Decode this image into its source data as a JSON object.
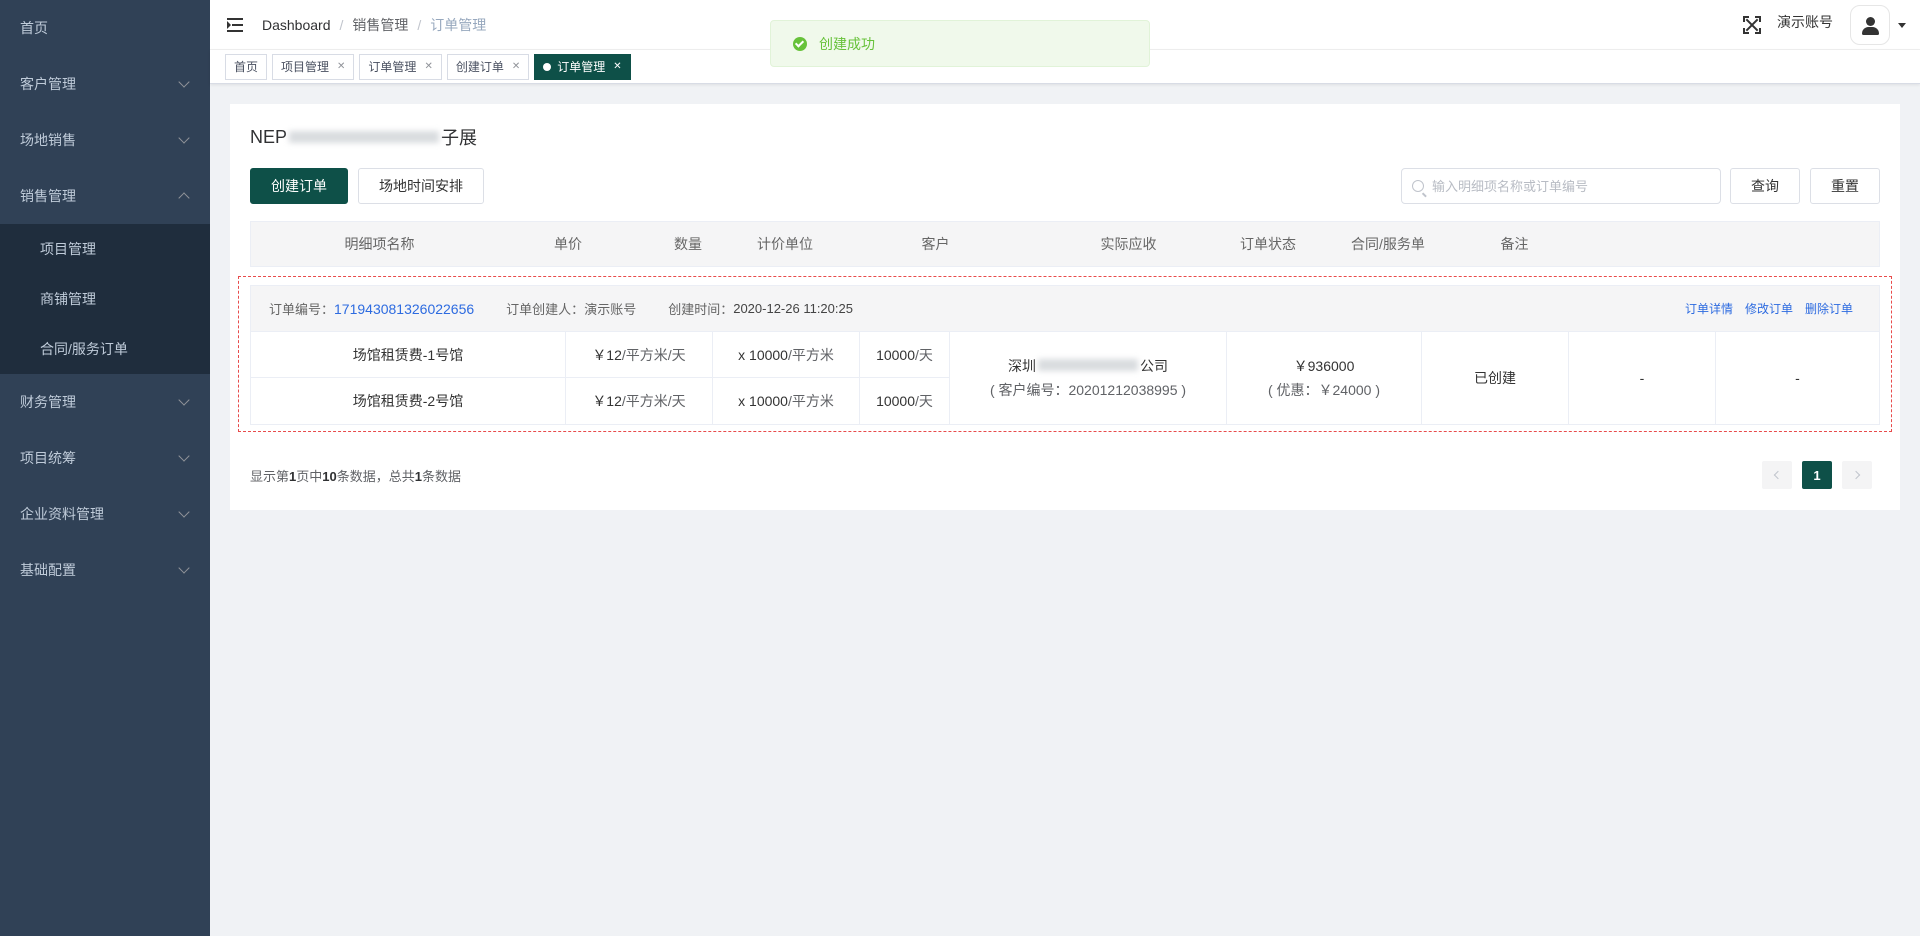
{
  "sidebar": {
    "items": [
      {
        "label": "首页"
      },
      {
        "label": "客户管理"
      },
      {
        "label": "场地销售"
      },
      {
        "label": "销售管理"
      },
      {
        "label": "财务管理"
      },
      {
        "label": "项目统筹"
      },
      {
        "label": "企业资料管理"
      },
      {
        "label": "基础配置"
      }
    ],
    "sales_submenu": [
      {
        "label": "项目管理"
      },
      {
        "label": "商铺管理"
      },
      {
        "label": "合同/服务订单"
      }
    ]
  },
  "navbar": {
    "breadcrumb": [
      "Dashboard",
      "销售管理",
      "订单管理"
    ],
    "user_name": "演示账号"
  },
  "tags": [
    {
      "label": "首页"
    },
    {
      "label": "项目管理"
    },
    {
      "label": "订单管理"
    },
    {
      "label": "创建订单"
    },
    {
      "label": "订单管理",
      "active": true
    }
  ],
  "toast": {
    "message": "创建成功"
  },
  "main": {
    "project_title_prefix": "NEP",
    "project_title_suffix": "子展",
    "create_order_label": "创建订单",
    "schedule_label": "场地时间安排",
    "search_placeholder": "输入明细项名称或订单编号",
    "query_label": "查询",
    "reset_label": "重置",
    "columns": [
      "明细项名称",
      "单价",
      "数量",
      "计价单位",
      "客户",
      "实际应收",
      "订单状态",
      "合同/服务单",
      "备注"
    ]
  },
  "order": {
    "no_label": "订单编号：",
    "no_value": "171943081326022656",
    "creator_label": "订单创建人：",
    "creator_value": "演示账号",
    "time_label": "创建时间：",
    "time_value": "2020-12-26 11:20:25",
    "actions": [
      "订单详情",
      "修改订单",
      "删除订单"
    ],
    "items": [
      {
        "name": "场馆租赁费-1号馆",
        "price": "￥12",
        "price_unit": "/平方米/天",
        "qty": "x 10000",
        "qty_unit": "/平方米",
        "billing": "10000",
        "billing_unit": "/天"
      },
      {
        "name": "场馆租赁费-2号馆",
        "price": "￥12",
        "price_unit": "/平方米/天",
        "qty": "x 10000",
        "qty_unit": "/平方米",
        "billing": "10000",
        "billing_unit": "/天"
      }
    ],
    "customer_prefix": "深圳",
    "customer_suffix": "公司",
    "customer_no": "( 客户编号：20201212038995 )",
    "receivable": "￥936000",
    "discount": "( 优惠：￥24000 )",
    "status": "已创建",
    "contract": "-",
    "remark": "-"
  },
  "pager": {
    "t1": "显示第",
    "page": "1",
    "t2": "页中",
    "size": "10",
    "t3": "条数据，总共",
    "total": "1",
    "t4": "条数据",
    "current": "1"
  },
  "colors": {
    "primary": "#0e5048",
    "sidebar": "#304156",
    "link": "#2d6be0",
    "success": "#67c23a"
  }
}
